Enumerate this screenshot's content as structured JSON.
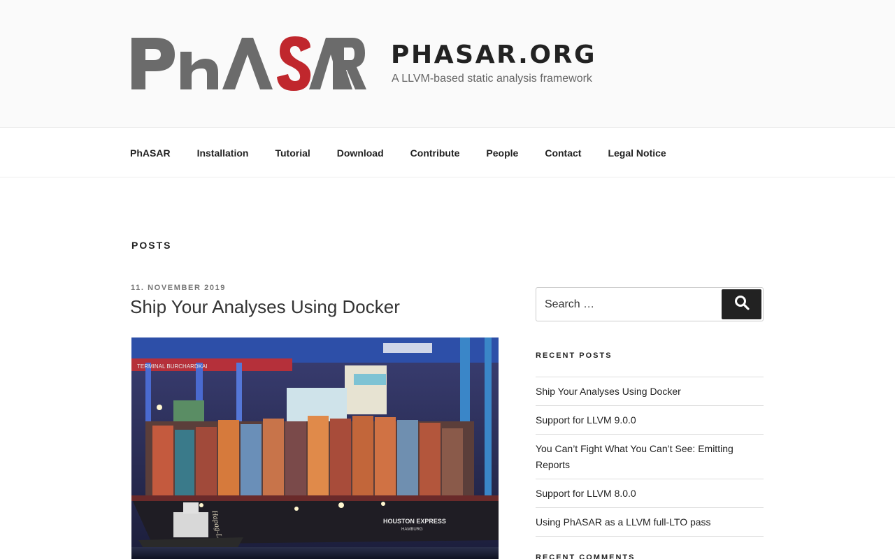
{
  "header": {
    "logo_text": "PhASAR",
    "site_title": "PHASAR.ORG",
    "site_description": "A LLVM-based static analysis framework"
  },
  "nav": {
    "items": [
      "PhASAR",
      "Installation",
      "Tutorial",
      "Download",
      "Contribute",
      "People",
      "Contact",
      "Legal Notice"
    ]
  },
  "main": {
    "page_title": "POSTS",
    "post": {
      "date": "11. NOVEMBER 2019",
      "title": "Ship Your Analyses Using Docker",
      "image_texts": [
        "TERMINAL BURCHARDKAI",
        "HOUSTON EXPRESS",
        "HAMBURG",
        "Hapag-Lloyd"
      ]
    }
  },
  "sidebar": {
    "search_placeholder": "Search …",
    "search_icon": "search-icon",
    "recent_posts_title": "RECENT POSTS",
    "recent_posts": [
      "Ship Your Analyses Using Docker",
      "Support for LLVM 9.0.0",
      "You Can’t Fight What You Can’t See: Emitting Reports",
      "Support for LLVM 8.0.0",
      "Using PhASAR as a LLVM full-LTO pass"
    ],
    "recent_comments_title": "RECENT COMMENTS"
  },
  "colors": {
    "logo_gray": "#6b6b6b",
    "logo_red": "#c0272d",
    "text": "#222222",
    "muted": "#767676",
    "header_bg": "#fafafa"
  }
}
